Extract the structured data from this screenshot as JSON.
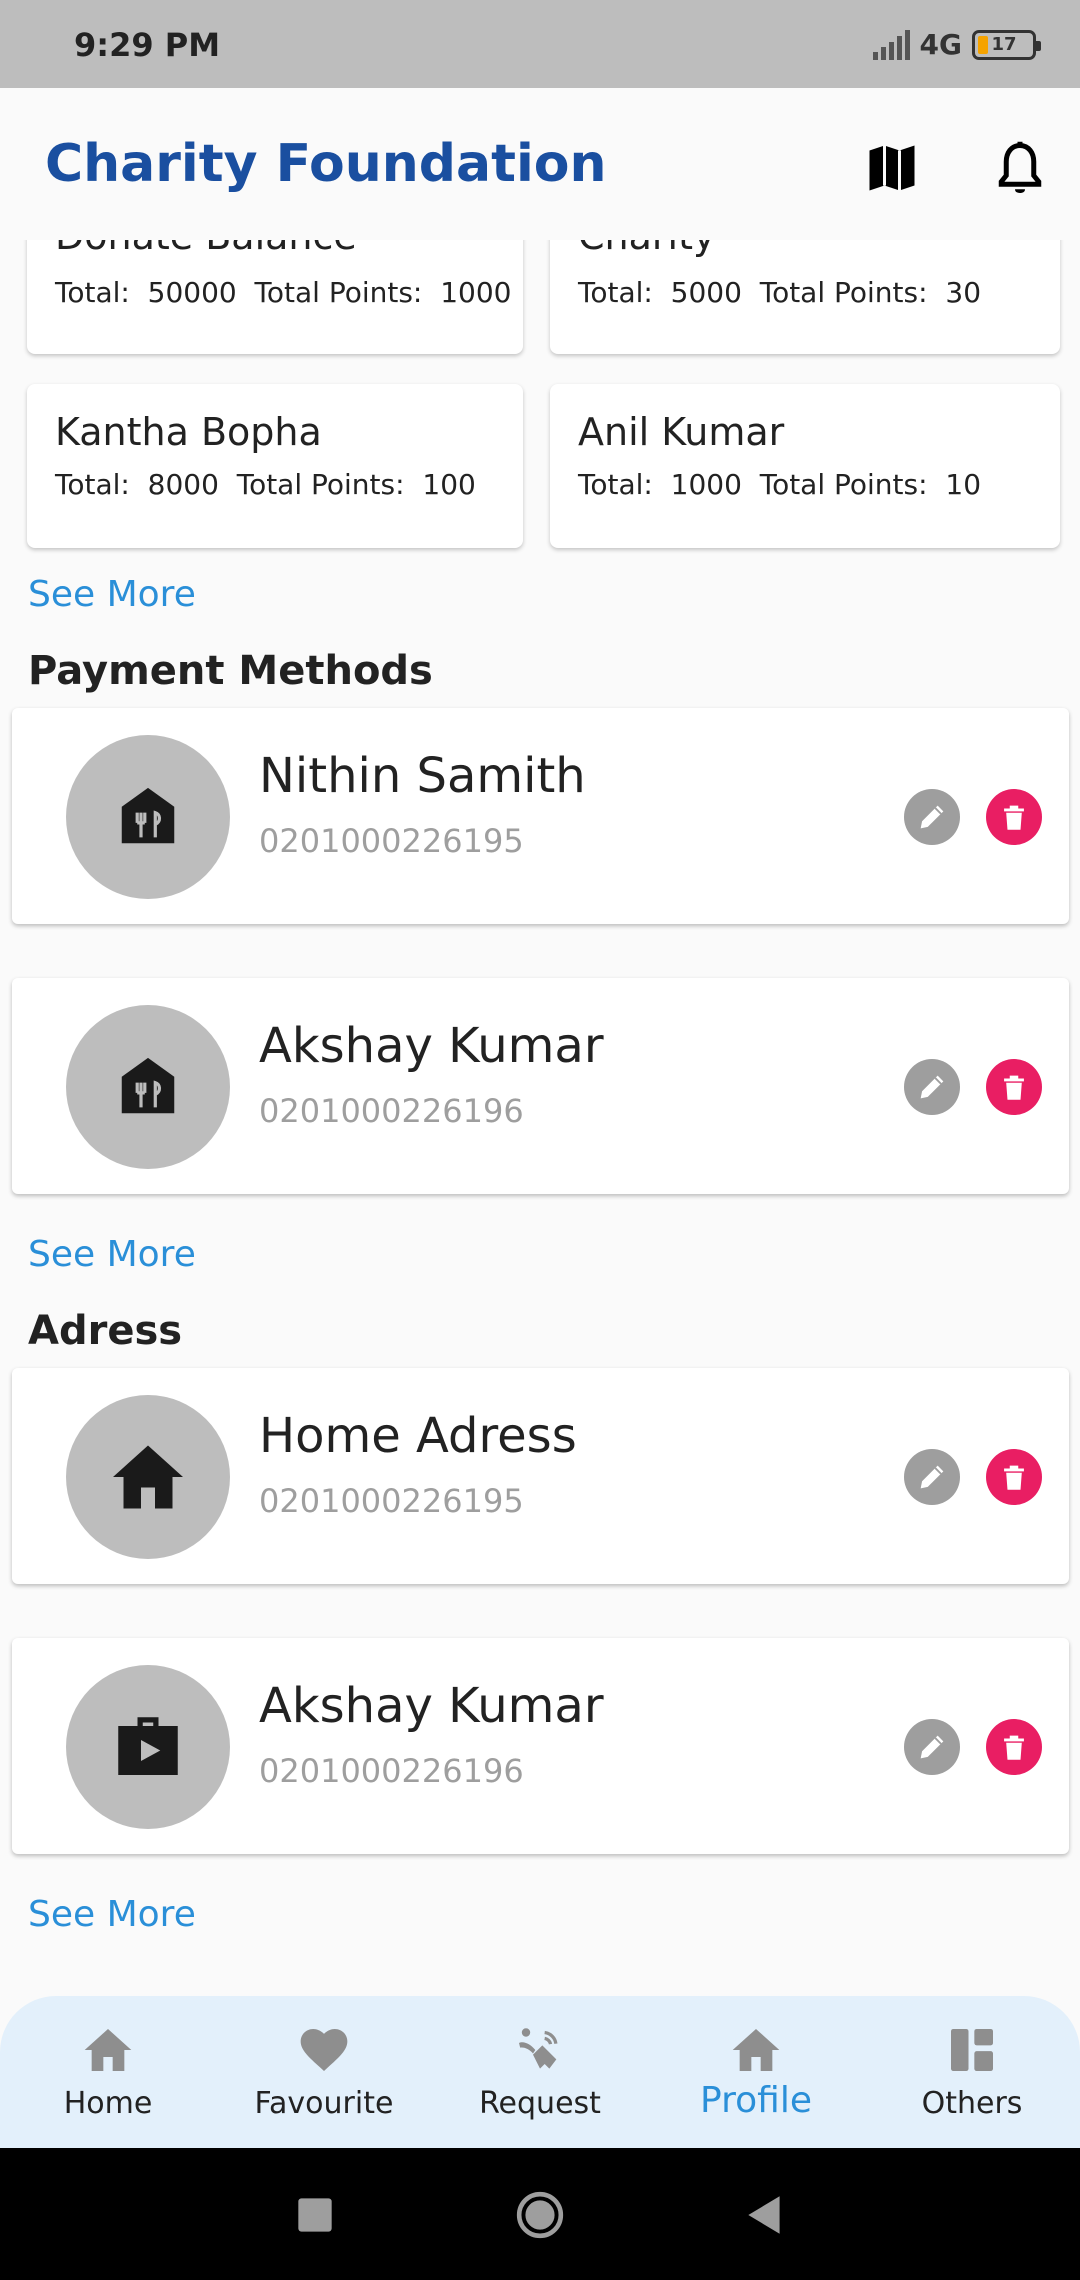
{
  "status_bar": {
    "time": "9:29 PM",
    "network": "4G",
    "battery": "17"
  },
  "app_bar": {
    "title": "Charity Foundation",
    "icons": [
      "map-icon",
      "bell-icon"
    ]
  },
  "summaries": [
    {
      "name": "Donate Balance",
      "total": "50000",
      "points": "1000"
    },
    {
      "name": "Charity",
      "total": "5000",
      "points": "30"
    },
    {
      "name": "Kantha Bopha",
      "total": "8000",
      "points": "100"
    },
    {
      "name": "Anil Kumar",
      "total": "1000",
      "points": "10"
    }
  ],
  "labels": {
    "total": "Total:",
    "total_points": "Total Points:",
    "see_more": "See More"
  },
  "payment_methods": {
    "title": "Payment Methods",
    "items": [
      {
        "name": "Nithin Samith",
        "number": "0201000226195",
        "icon": "restaurant-icon"
      },
      {
        "name": "Akshay Kumar",
        "number": "0201000226196",
        "icon": "restaurant-icon"
      }
    ]
  },
  "address": {
    "title": "Adress",
    "items": [
      {
        "name": "Home Adress",
        "number": "0201000226195",
        "icon": "home-icon"
      },
      {
        "name": "Akshay Kumar",
        "number": "0201000226196",
        "icon": "work-icon"
      }
    ]
  },
  "bottom_nav": [
    {
      "label": "Home",
      "icon": "home-icon",
      "active": false
    },
    {
      "label": "Favourite",
      "icon": "heart-icon",
      "active": false
    },
    {
      "label": "Request",
      "icon": "request-icon",
      "active": false
    },
    {
      "label": "Profile",
      "icon": "home-icon",
      "active": true
    },
    {
      "label": "Others",
      "icon": "dashboard-icon",
      "active": false
    }
  ],
  "colors": {
    "brand": "#1a4fa0",
    "link": "#2a8fd8",
    "delete": "#e91e63",
    "nav_bg": "#e3f0fb"
  }
}
